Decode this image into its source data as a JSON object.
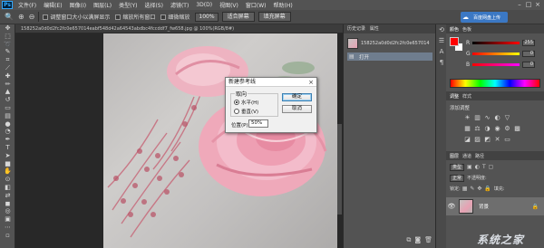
{
  "app": {
    "logo": "Ps"
  },
  "menubar": {
    "items": [
      "文件(F)",
      "编辑(E)",
      "图像(I)",
      "图层(L)",
      "类型(Y)",
      "选择(S)",
      "滤镜(T)",
      "3D(D)",
      "视图(V)",
      "窗口(W)",
      "帮助(H)"
    ],
    "window_controls": {
      "minimize": "–",
      "restore": "□",
      "close": "×"
    }
  },
  "options_bar": {
    "tool_icon": "zoom-icon",
    "checkboxes": [
      "调整窗口大小以满屏显示",
      "缩放所有窗口",
      "细微缩放"
    ],
    "zoom_field": "100%",
    "buttons": [
      "适合屏幕",
      "填充屏幕"
    ],
    "upload_label": "百度网盘上传"
  },
  "toolbar": {
    "tools": [
      "move-tool-icon",
      "marquee-tool-icon",
      "lasso-tool-icon",
      "quick-select-tool-icon",
      "crop-tool-icon",
      "eyedropper-tool-icon",
      "healing-brush-tool-icon",
      "brush-tool-icon",
      "clone-stamp-tool-icon",
      "history-brush-tool-icon",
      "eraser-tool-icon",
      "gradient-tool-icon",
      "blur-tool-icon",
      "dodge-tool-icon",
      "pen-tool-icon",
      "type-tool-icon",
      "path-select-tool-icon",
      "shape-tool-icon",
      "hand-tool-icon",
      "zoom-tool-icon",
      "default-colors-icon",
      "swap-colors-icon",
      "color-swatch-icon",
      "quick-mask-icon",
      "screen-mode-icon",
      "more-tools-icon",
      "extra-tool-icon"
    ]
  },
  "document": {
    "tab_title": "158252a0d0d2fc2fc0e657014eabf548d42a64543abdbc4fccddf7_fw658.jpg @ 100%(RGB/8#)",
    "colors": {
      "background": "#282828",
      "photo_tone": "#c8c6c4",
      "petal": "#e89aae"
    }
  },
  "dialog": {
    "title": "新建参考线",
    "close": "×",
    "orientation_legend": "取向",
    "orientation_options": [
      "水平(H)",
      "垂直(V)"
    ],
    "orientation_selected": "水平(H)",
    "position_label": "位置(P):",
    "position_value": "50%",
    "ok_label": "确定",
    "cancel_label": "取消"
  },
  "history_panel": {
    "tabs": [
      "历史记录",
      "属性"
    ],
    "snapshot_name": "158252a0d0d2fc2fc0e657014...",
    "states": [
      "打开"
    ]
  },
  "color_panel": {
    "tabs": [
      "颜色",
      "色板"
    ],
    "foreground": "#ff0000",
    "background": "#ffffff",
    "sliders": [
      {
        "label": "R",
        "value": "255"
      },
      {
        "label": "G",
        "value": "0"
      },
      {
        "label": "B",
        "value": "0"
      }
    ]
  },
  "adjustments_panel": {
    "tabs": [
      "调整",
      "样式"
    ],
    "title": "添加调整"
  },
  "layers_panel": {
    "tabs": [
      "图层",
      "通道",
      "路径"
    ],
    "filter_label": "类型",
    "blend_mode": "正常",
    "opacity_label": "不透明度:",
    "lock_label": "锁定:",
    "fill_label": "填充:",
    "layers": [
      {
        "name": "背景",
        "visible": true,
        "locked": true
      }
    ]
  },
  "watermark": {
    "text": "系统之家"
  }
}
